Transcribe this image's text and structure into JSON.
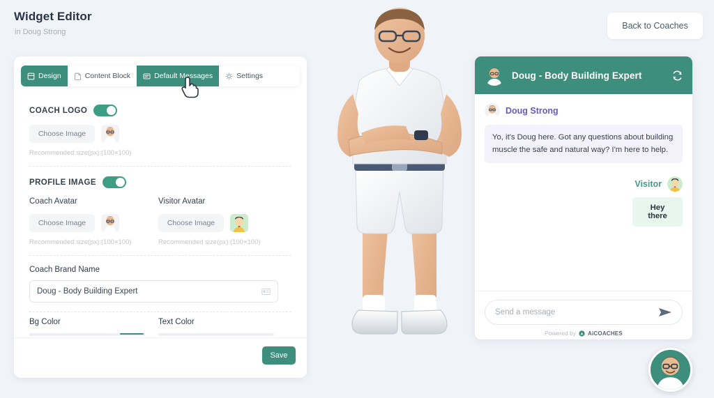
{
  "header": {
    "title": "Widget Editor",
    "subtitle": "in Doug Strong",
    "back_button": "Back to Coaches"
  },
  "tabs": [
    {
      "label": "Design",
      "icon": "layout-icon",
      "active": true
    },
    {
      "label": "Content Block",
      "icon": "content-block-icon",
      "active": false
    },
    {
      "label": "Default Messages",
      "icon": "message-icon",
      "active": true
    },
    {
      "label": "Settings",
      "icon": "gear-icon",
      "active": false
    }
  ],
  "form": {
    "coach_logo": {
      "label": "COACH LOGO",
      "toggle_on": true,
      "choose_label": "Choose Image",
      "hint": "Recommended size(px):(100×100)"
    },
    "profile_image": {
      "label": "PROFILE IMAGE",
      "toggle_on": true,
      "coach_avatar": {
        "label": "Coach Avatar",
        "choose_label": "Choose Image",
        "hint": "Recommended size(px):(100×100)"
      },
      "visitor_avatar": {
        "label": "Visitor Avatar",
        "choose_label": "Choose Image",
        "hint": "Recommended size(px):(100×100)"
      }
    },
    "coach_brand_name": {
      "label": "Coach Brand Name",
      "value": "Doug - Body Building Expert"
    },
    "bg_color": {
      "label": "Bg Color"
    },
    "text_color": {
      "label": "Text Color"
    },
    "save_label": "Save"
  },
  "chat": {
    "header_title": "Doug - Body Building Expert",
    "refresh_icon": "refresh-icon",
    "messages": [
      {
        "sender": "Doug Strong",
        "side": "left",
        "text": "Yo, it's Doug here. Got any questions about building muscle the safe and natural way? I'm here to help."
      },
      {
        "sender": "Visitor",
        "side": "right",
        "text": "Hey there"
      }
    ],
    "input_placeholder": "Send a message",
    "send_icon": "send-icon",
    "powered_by_text": "Powered by",
    "powered_by_brand": "AiCOACHES"
  },
  "fab": {
    "name": "chat-launcher"
  },
  "colors": {
    "accent": "#3e8e7e",
    "toggle_on": "#3e9d85",
    "page_bg": "#f0f3f8",
    "coach_bubble": "#f3f2fb",
    "visitor_bubble": "#e7f7ee",
    "coach_name": "#6a5ab8",
    "visitor_name": "#3e9d85"
  }
}
